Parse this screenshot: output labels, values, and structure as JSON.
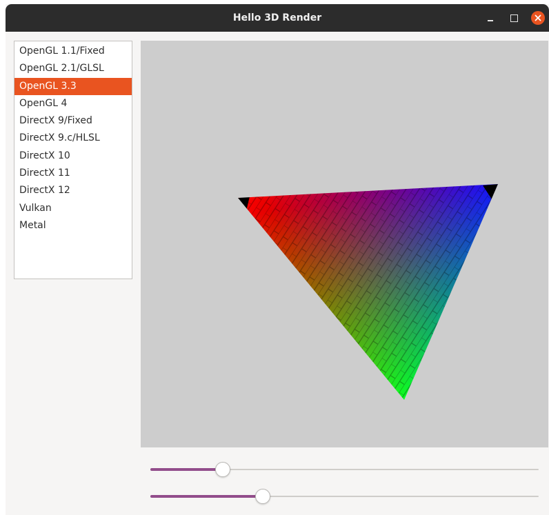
{
  "window": {
    "title": "Hello 3D Render",
    "controls": [
      "minimize-icon",
      "maximize-icon",
      "close-icon"
    ],
    "accent_color": "#e95420",
    "titlebar_color": "#2c2c2c"
  },
  "renderer_list": {
    "items": [
      "OpenGL 1.1/Fixed",
      "OpenGL 2.1/GLSL",
      "OpenGL 3.3",
      "OpenGL 4",
      "DirectX 9/Fixed",
      "DirectX 9.c/HLSL",
      "DirectX 10",
      "DirectX 11",
      "DirectX 12",
      "Vulkan",
      "Metal"
    ],
    "selected_index": 2
  },
  "viewport": {
    "background_color": "#cdcdcd",
    "vertex_colors": [
      "#ff0000",
      "#00ff00",
      "#0000ff"
    ]
  },
  "sliders": [
    {
      "value": 0.186,
      "fill_color": "#924d8b"
    },
    {
      "value": 0.29,
      "fill_color": "#924d8b"
    }
  ]
}
